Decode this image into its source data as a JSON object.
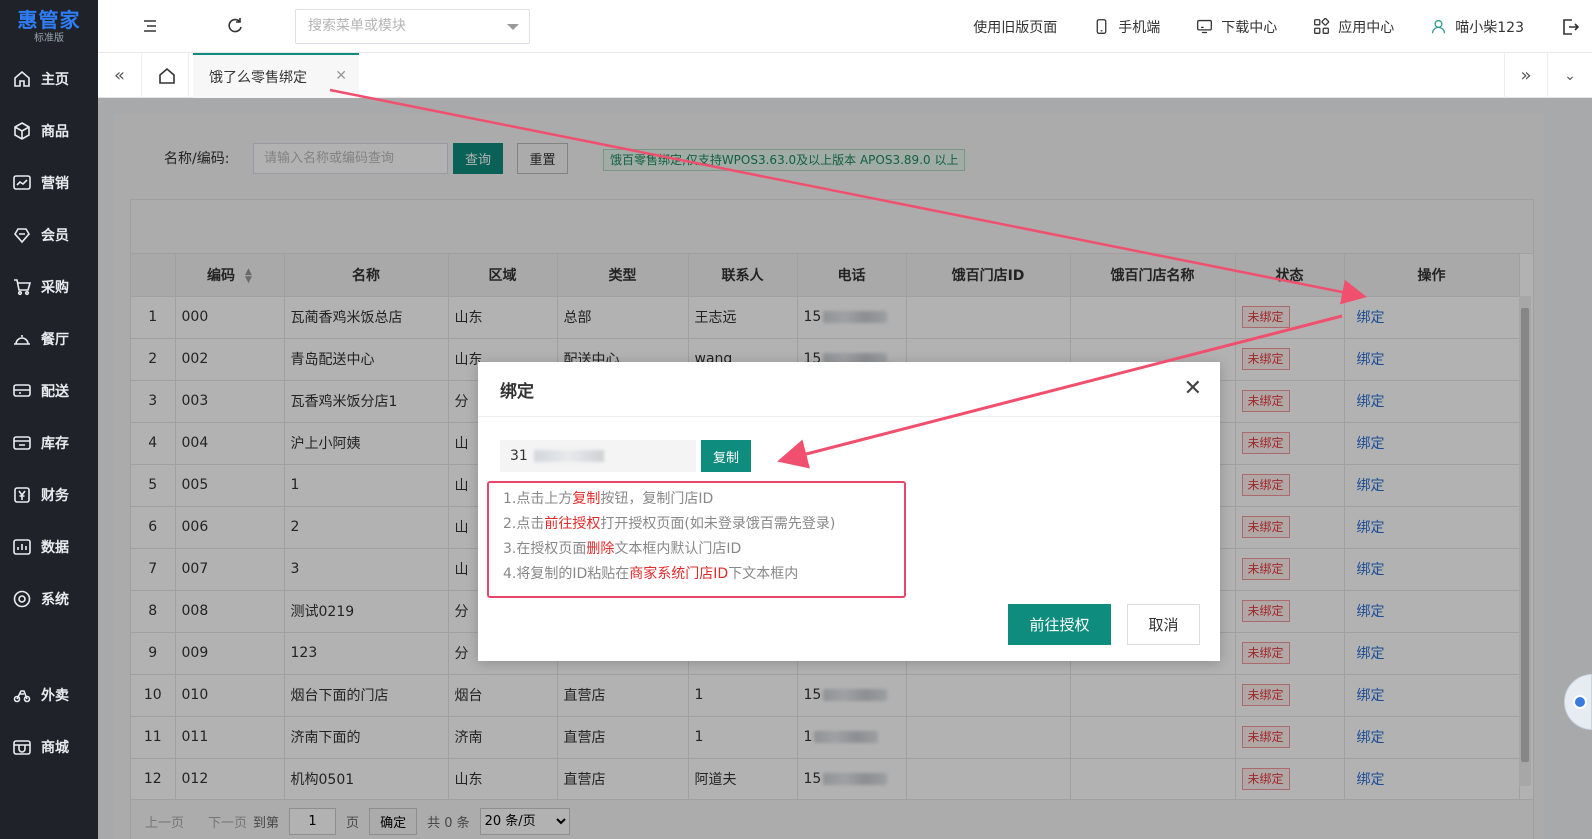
{
  "app": {
    "logo": "惠管家",
    "edition": "标准版"
  },
  "sidebar": {
    "items": [
      {
        "label": "主页"
      },
      {
        "label": "商品"
      },
      {
        "label": "营销"
      },
      {
        "label": "会员"
      },
      {
        "label": "采购"
      },
      {
        "label": "餐厅"
      },
      {
        "label": "配送"
      },
      {
        "label": "库存"
      },
      {
        "label": "财务"
      },
      {
        "label": "数据"
      },
      {
        "label": "系统"
      }
    ],
    "bottom_items": [
      {
        "label": "外卖"
      },
      {
        "label": "商城"
      }
    ]
  },
  "header": {
    "search_placeholder": "搜索菜单或模块",
    "old_page": "使用旧版页面",
    "mobile": "手机端",
    "download": "下载中心",
    "apps": "应用中心",
    "user": "喵小柴123"
  },
  "tabs": {
    "active": "饿了么零售绑定"
  },
  "filter": {
    "label": "名称/编码:",
    "placeholder": "请输入名称或编码查询",
    "query": "查询",
    "reset": "重置",
    "notice": "饿百零售绑定,仅支持WPOS3.63.0及以上版本 APOS3.89.0 以上"
  },
  "table": {
    "columns": [
      "",
      "编码",
      "名称",
      "区域",
      "类型",
      "联系人",
      "电话",
      "饿百门店ID",
      "饿百门店名称",
      "状态",
      "操作"
    ],
    "rows": [
      {
        "idx": "1",
        "code": "000",
        "name": "瓦蔺香鸡米饭总店",
        "region": "山东",
        "type": "总部",
        "contact": "王志远",
        "phone": "15",
        "status": "未绑定",
        "action": "绑定"
      },
      {
        "idx": "2",
        "code": "002",
        "name": "青岛配送中心",
        "region": "山东",
        "type": "配送中心",
        "contact": "wang",
        "phone": "15",
        "status": "未绑定",
        "action": "绑定"
      },
      {
        "idx": "3",
        "code": "003",
        "name": "瓦香鸡米饭分店1",
        "region": "分",
        "type": "",
        "contact": "",
        "phone": "",
        "status": "未绑定",
        "action": "绑定"
      },
      {
        "idx": "4",
        "code": "004",
        "name": "沪上小阿姨",
        "region": "山",
        "type": "",
        "contact": "",
        "phone": "",
        "status": "未绑定",
        "action": "绑定"
      },
      {
        "idx": "5",
        "code": "005",
        "name": "1",
        "region": "山",
        "type": "",
        "contact": "",
        "phone": "",
        "status": "未绑定",
        "action": "绑定"
      },
      {
        "idx": "6",
        "code": "006",
        "name": "2",
        "region": "山",
        "type": "",
        "contact": "",
        "phone": "",
        "status": "未绑定",
        "action": "绑定"
      },
      {
        "idx": "7",
        "code": "007",
        "name": "3",
        "region": "山",
        "type": "",
        "contact": "",
        "phone": "",
        "status": "未绑定",
        "action": "绑定"
      },
      {
        "idx": "8",
        "code": "008",
        "name": "测试0219",
        "region": "分",
        "type": "",
        "contact": "",
        "phone": "",
        "status": "未绑定",
        "action": "绑定"
      },
      {
        "idx": "9",
        "code": "009",
        "name": "123",
        "region": "分",
        "type": "",
        "contact": "",
        "phone": "",
        "status": "未绑定",
        "action": "绑定"
      },
      {
        "idx": "10",
        "code": "010",
        "name": "烟台下面的门店",
        "region": "烟台",
        "type": "直营店",
        "contact": "1",
        "phone": "15",
        "status": "未绑定",
        "action": "绑定"
      },
      {
        "idx": "11",
        "code": "011",
        "name": "济南下面的",
        "region": "济南",
        "type": "直营店",
        "contact": "1",
        "phone": "1",
        "status": "未绑定",
        "action": "绑定"
      },
      {
        "idx": "12",
        "code": "012",
        "name": "机构0501",
        "region": "山东",
        "type": "直营店",
        "contact": "阿道夫",
        "phone": "15",
        "status": "未绑定",
        "action": "绑定"
      }
    ]
  },
  "pager": {
    "prev": "上一页",
    "next": "下一页",
    "goto": "到第",
    "page": "1",
    "page_unit": "页",
    "confirm": "确定",
    "total": "共 0 条",
    "per_page": "20 条/页"
  },
  "modal": {
    "title": "绑定",
    "store_id": "31",
    "copy": "复制",
    "steps": [
      {
        "pre": "1.点击上方",
        "hl": "复制",
        "post": "按钮，复制门店ID"
      },
      {
        "pre": "2.点击",
        "hl": "前往授权",
        "post": "打开授权页面(如未登录饿百需先登录)"
      },
      {
        "pre": "3.在授权页面",
        "hl": "删除",
        "post": "文本框内默认门店ID"
      },
      {
        "pre": "4.将复制的ID粘贴在",
        "hl": "商家系统门店ID",
        "post": "下文本框内"
      }
    ],
    "authorize": "前往授权",
    "cancel": "取消"
  },
  "colors": {
    "primary": "#0e8c7e",
    "sidebar_bg": "#1f2329",
    "danger": "#e23b3b",
    "arrow": "#f0506e"
  }
}
